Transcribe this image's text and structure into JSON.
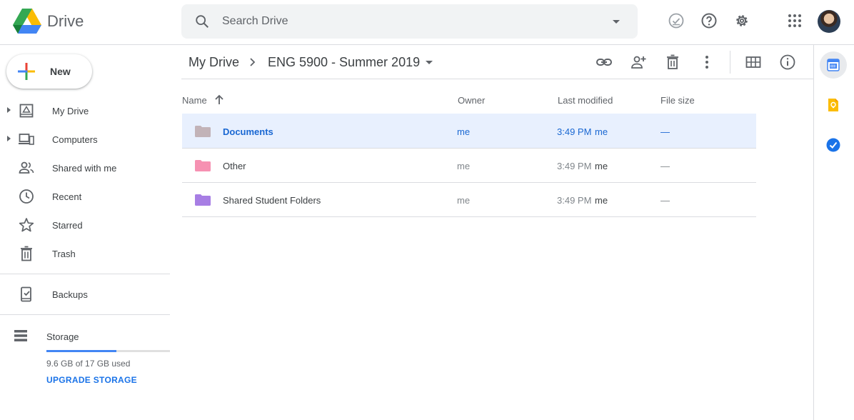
{
  "app": {
    "name": "Drive"
  },
  "search": {
    "placeholder": "Search Drive"
  },
  "sidebar": {
    "new_label": "New",
    "items": [
      {
        "label": "My Drive",
        "icon": "my-drive-icon",
        "expandable": true
      },
      {
        "label": "Computers",
        "icon": "computers-icon",
        "expandable": true
      },
      {
        "label": "Shared with me",
        "icon": "shared-with-me-icon",
        "expandable": false
      },
      {
        "label": "Recent",
        "icon": "clock-icon",
        "expandable": false
      },
      {
        "label": "Starred",
        "icon": "star-icon",
        "expandable": false
      },
      {
        "label": "Trash",
        "icon": "trash-icon",
        "expandable": false
      },
      {
        "label": "Backups",
        "icon": "backups-icon",
        "expandable": false
      }
    ],
    "storage": {
      "title": "Storage",
      "used_text": "9.6 GB of 17 GB used",
      "used_fraction": 0.565,
      "upgrade_label": "UPGRADE STORAGE"
    }
  },
  "breadcrumb": {
    "root": "My Drive",
    "current": "ENG 5900 - Summer 2019"
  },
  "columns": {
    "name": "Name",
    "owner": "Owner",
    "modified": "Last modified",
    "size": "File size"
  },
  "files": [
    {
      "name": "Documents",
      "owner": "me",
      "modified": "3:49 PM",
      "modified_by": "me",
      "size": "—",
      "folder_color": "#c2b3b8",
      "selected": true
    },
    {
      "name": "Other",
      "owner": "me",
      "modified": "3:49 PM",
      "modified_by": "me",
      "size": "—",
      "folder_color": "#f691b2",
      "selected": false
    },
    {
      "name": "Shared Student Folders",
      "owner": "me",
      "modified": "3:49 PM",
      "modified_by": "me",
      "size": "—",
      "folder_color": "#a77ee4",
      "selected": false
    }
  ],
  "colors": {
    "accent": "#1a73e8",
    "selected_row": "#e8f0fe"
  }
}
